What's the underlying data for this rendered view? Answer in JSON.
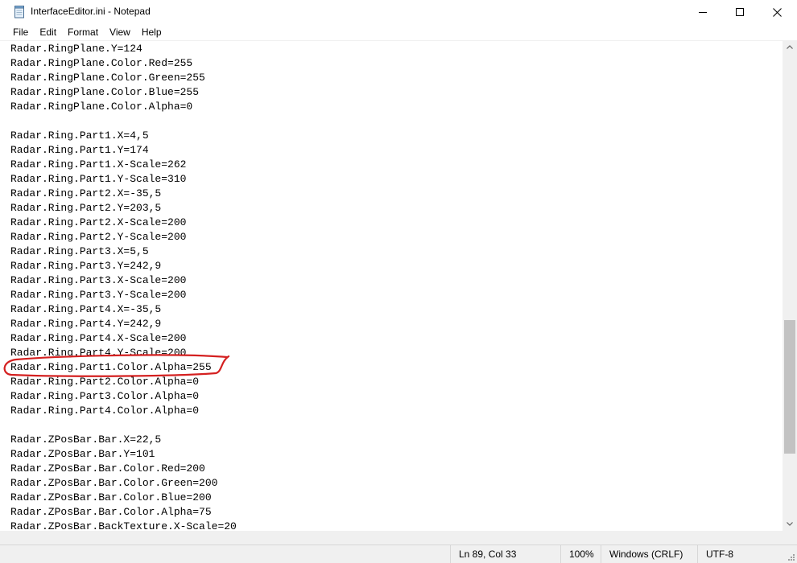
{
  "window": {
    "title": "InterfaceEditor.ini - Notepad",
    "app_icon": "notepad-icon",
    "controls": {
      "minimize_icon": "minimize-icon",
      "maximize_icon": "maximize-icon",
      "close_icon": "close-icon"
    }
  },
  "menu": {
    "items": [
      {
        "label": "File"
      },
      {
        "label": "Edit"
      },
      {
        "label": "Format"
      },
      {
        "label": "View"
      },
      {
        "label": "Help"
      }
    ]
  },
  "editor": {
    "lines": [
      "Radar.RingPlane.Y=124",
      "Radar.RingPlane.Color.Red=255",
      "Radar.RingPlane.Color.Green=255",
      "Radar.RingPlane.Color.Blue=255",
      "Radar.RingPlane.Color.Alpha=0",
      "",
      "Radar.Ring.Part1.X=4,5",
      "Radar.Ring.Part1.Y=174",
      "Radar.Ring.Part1.X-Scale=262",
      "Radar.Ring.Part1.Y-Scale=310",
      "Radar.Ring.Part2.X=-35,5",
      "Radar.Ring.Part2.Y=203,5",
      "Radar.Ring.Part2.X-Scale=200",
      "Radar.Ring.Part2.Y-Scale=200",
      "Radar.Ring.Part3.X=5,5",
      "Radar.Ring.Part3.Y=242,9",
      "Radar.Ring.Part3.X-Scale=200",
      "Radar.Ring.Part3.Y-Scale=200",
      "Radar.Ring.Part4.X=-35,5",
      "Radar.Ring.Part4.Y=242,9",
      "Radar.Ring.Part4.X-Scale=200",
      "Radar.Ring.Part4.Y-Scale=200",
      "Radar.Ring.Part1.Color.Alpha=255",
      "Radar.Ring.Part2.Color.Alpha=0",
      "Radar.Ring.Part3.Color.Alpha=0",
      "Radar.Ring.Part4.Color.Alpha=0",
      "",
      "Radar.ZPosBar.Bar.X=22,5",
      "Radar.ZPosBar.Bar.Y=101",
      "Radar.ZPosBar.Bar.Color.Red=200",
      "Radar.ZPosBar.Bar.Color.Green=200",
      "Radar.ZPosBar.Bar.Color.Blue=200",
      "Radar.ZPosBar.Bar.Color.Alpha=75",
      "Radar.ZPosBar.BackTexture.X-Scale=20"
    ],
    "highlighted_line_index": 22,
    "annotation_color": "#d42020"
  },
  "scrollbar": {
    "up_icon": "scroll-up-arrow-icon",
    "down_icon": "scroll-down-arrow-icon"
  },
  "status": {
    "position": "Ln 89, Col 33",
    "zoom": "100%",
    "line_ending": "Windows (CRLF)",
    "encoding": "UTF-8"
  }
}
